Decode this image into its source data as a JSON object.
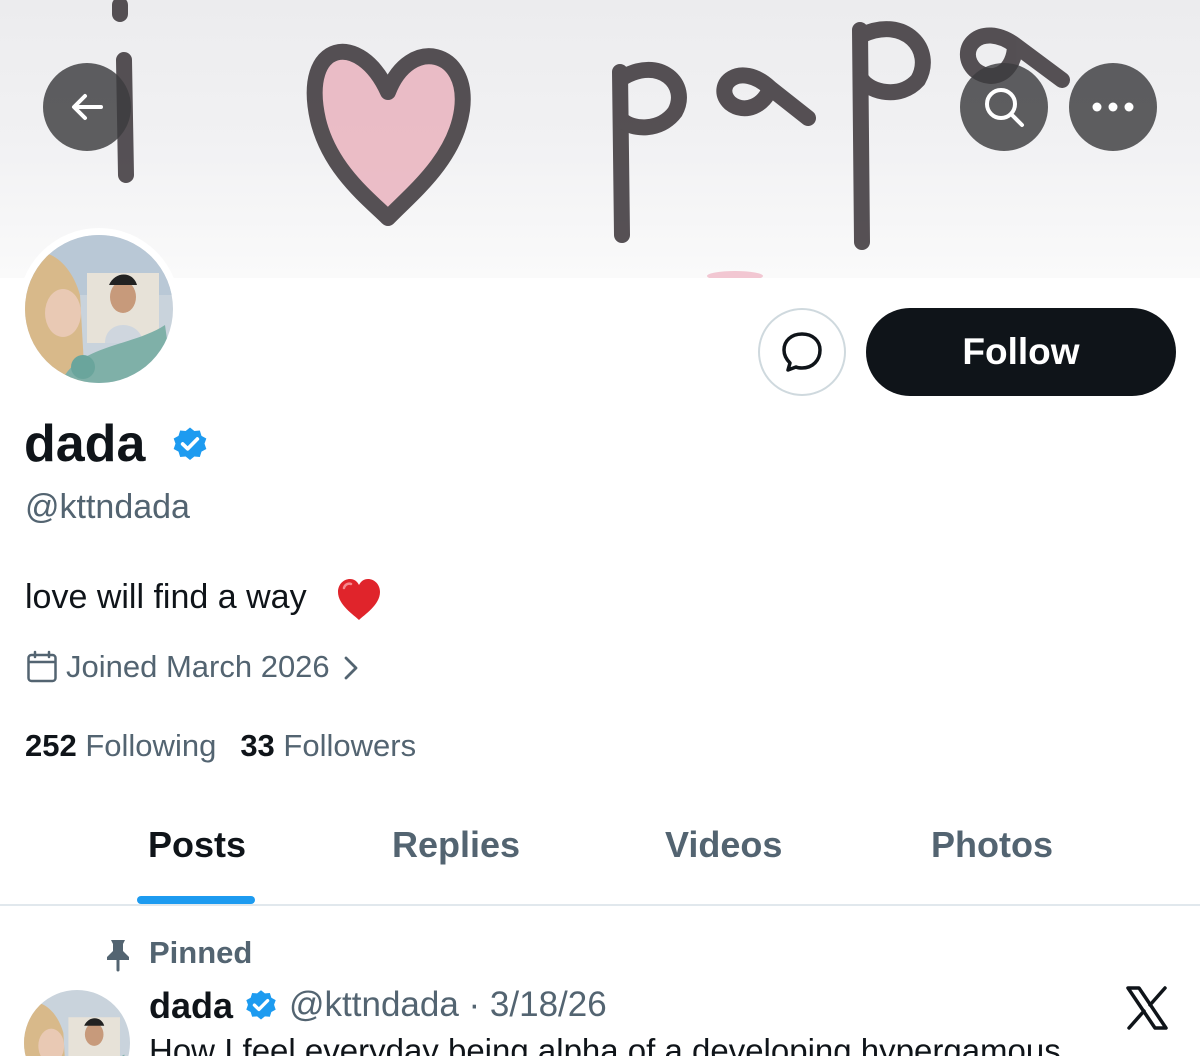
{
  "banner": {
    "handwriting_text": "i ♡ papa",
    "heart_color": "#eab4bf"
  },
  "nav": {
    "back_icon": "arrow-left-icon",
    "search_icon": "search-icon",
    "more_icon": "more-horizontal-icon"
  },
  "profile": {
    "display_name": "dada",
    "handle": "@kttndada",
    "bio": "love will find a way",
    "bio_emoji": "red-heart-emoji",
    "joined": "Joined March 2026",
    "verified_color": "#1d9bf0"
  },
  "actions": {
    "message_icon": "message-bubble-icon",
    "follow_label": "Follow"
  },
  "stats": {
    "following_count": "252",
    "following_label": "Following",
    "followers_count": "33",
    "followers_label": "Followers"
  },
  "tabs": [
    {
      "label": "Posts",
      "active": true
    },
    {
      "label": "Replies",
      "active": false
    },
    {
      "label": "Videos",
      "active": false
    },
    {
      "label": "Photos",
      "active": false
    }
  ],
  "pinned_post": {
    "pinned_label": "Pinned",
    "author_name": "dada",
    "author_handle": "@kttndada",
    "separator": "·",
    "date": "3/18/26",
    "meta": "@kttndada · 3/18/26",
    "text": "How I feel everyday being alpha of a developing hypergamous"
  },
  "colors": {
    "accent": "#1d9bf0",
    "text_primary": "#0f1419",
    "text_secondary": "#536471",
    "follow_bg": "#0f1419"
  }
}
